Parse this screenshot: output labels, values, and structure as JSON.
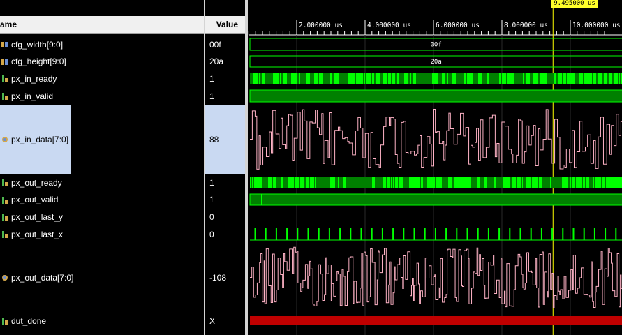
{
  "columns": {
    "name": "ame",
    "value": "Value"
  },
  "signals": [
    {
      "name": "cfg_width[9:0]",
      "value": "00f",
      "icon": "bus-icon",
      "kind": "bus",
      "bus_label": "00f"
    },
    {
      "name": "cfg_height[9:0]",
      "value": "20a",
      "icon": "bus-icon",
      "kind": "bus",
      "bus_label": "20a"
    },
    {
      "name": "px_in_ready",
      "value": "1",
      "icon": "bit-icon",
      "kind": "bit-dense"
    },
    {
      "name": "px_in_valid",
      "value": "1",
      "icon": "bit-icon",
      "kind": "bit-high"
    },
    {
      "name": "px_in_data[7:0]",
      "value": "88",
      "icon": "analog-icon",
      "kind": "analog",
      "selected": true
    },
    {
      "name": "px_out_ready",
      "value": "1",
      "icon": "bit-icon",
      "kind": "bit-dense"
    },
    {
      "name": "px_out_valid",
      "value": "1",
      "icon": "bit-icon",
      "kind": "bit-valid"
    },
    {
      "name": "px_out_last_y",
      "value": "0",
      "icon": "bit-icon",
      "kind": "bit-low"
    },
    {
      "name": "px_out_last_x",
      "value": "0",
      "icon": "bit-icon",
      "kind": "bit-pulses"
    },
    {
      "name": "px_out_data[7:0]",
      "value": "-108",
      "icon": "analog-icon",
      "kind": "analog2"
    },
    {
      "name": "dut_done",
      "value": "X",
      "icon": "bit-icon",
      "kind": "bit-x"
    }
  ],
  "timeline": {
    "ticks": [
      "2.000000 us",
      "4.000000 us",
      "6.000000 us",
      "8.000000 us",
      "10.000000 us"
    ],
    "cursor": "9.495000 us"
  },
  "colors": {
    "wave_green": "#00ff00",
    "wave_dark_green": "#008000",
    "analog_pink": "#ffb3c6",
    "x_red": "#c00000",
    "cursor": "#ffff00",
    "grid": "#2a2a2a"
  }
}
